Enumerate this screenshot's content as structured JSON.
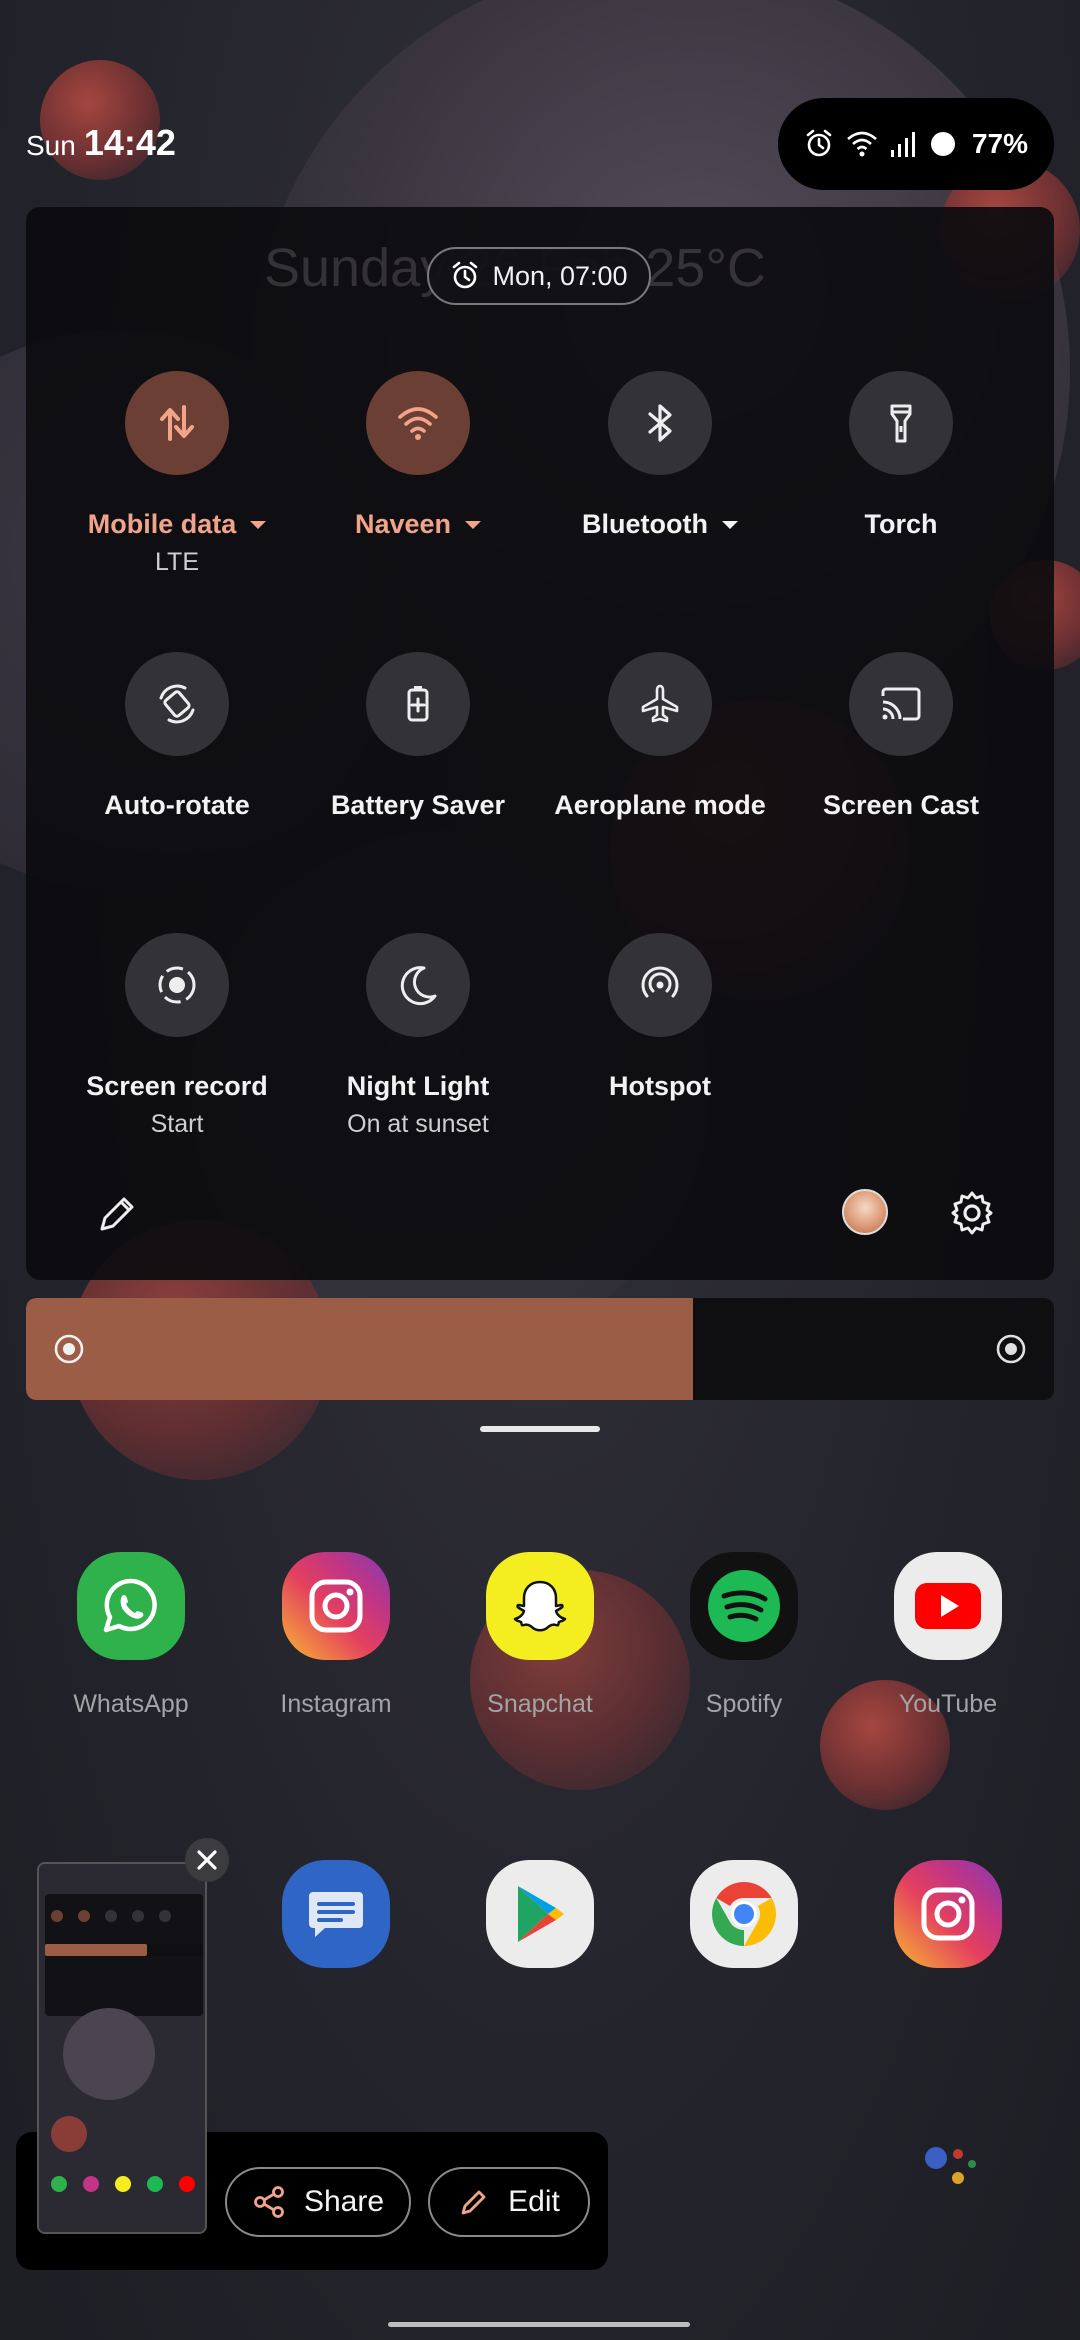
{
  "status_bar": {
    "day": "Sun",
    "time": "14:42",
    "battery_percent": "77%"
  },
  "quick_settings": {
    "header_ghost": "Sunday 26 Feb  25°C",
    "alarm_chip": "Mon, 07:00",
    "tiles": [
      {
        "label": "Mobile data",
        "sub": "LTE",
        "icon": "swap-vertical-icon",
        "active": true,
        "has_caret": true
      },
      {
        "label": "Naveen",
        "sub": "",
        "icon": "wifi-icon",
        "active": true,
        "has_caret": true
      },
      {
        "label": "Bluetooth",
        "sub": "",
        "icon": "bluetooth-icon",
        "active": false,
        "has_caret": true
      },
      {
        "label": "Torch",
        "sub": "",
        "icon": "flashlight-icon",
        "active": false,
        "has_caret": false
      },
      {
        "label": "Auto-rotate",
        "sub": "",
        "icon": "auto-rotate-icon",
        "active": false,
        "has_caret": false
      },
      {
        "label": "Battery Saver",
        "sub": "",
        "icon": "battery-saver-icon",
        "active": false,
        "has_caret": false
      },
      {
        "label": "Aeroplane mode",
        "sub": "",
        "icon": "airplane-icon",
        "active": false,
        "has_caret": false
      },
      {
        "label": "Screen Cast",
        "sub": "",
        "icon": "cast-icon",
        "active": false,
        "has_caret": false
      },
      {
        "label": "Screen record",
        "sub": "Start",
        "icon": "screen-record-icon",
        "active": false,
        "has_caret": false
      },
      {
        "label": "Night Light",
        "sub": "On at sunset",
        "icon": "moon-icon",
        "active": false,
        "has_caret": false
      },
      {
        "label": "Hotspot",
        "sub": "",
        "icon": "hotspot-icon",
        "active": false,
        "has_caret": false
      }
    ]
  },
  "brightness": {
    "level": 0.649
  },
  "apps": [
    {
      "label": "WhatsApp",
      "icon": "whatsapp-icon"
    },
    {
      "label": "Instagram",
      "icon": "instagram-icon"
    },
    {
      "label": "Snapchat",
      "icon": "snapchat-icon"
    },
    {
      "label": "Spotify",
      "icon": "spotify-icon"
    },
    {
      "label": "YouTube",
      "icon": "youtube-icon"
    }
  ],
  "dock": [
    {
      "icon": "messages-icon"
    },
    {
      "icon": "play-store-icon"
    },
    {
      "icon": "chrome-icon"
    },
    {
      "icon": "instagram-icon"
    }
  ],
  "screenshot_actions": {
    "share_label": "Share",
    "edit_label": "Edit"
  },
  "colors": {
    "accent": "#f2a48a",
    "active_tile": "#6b3f34",
    "inactive_tile": "#333237",
    "brightness_fill": "#9b5d45"
  }
}
